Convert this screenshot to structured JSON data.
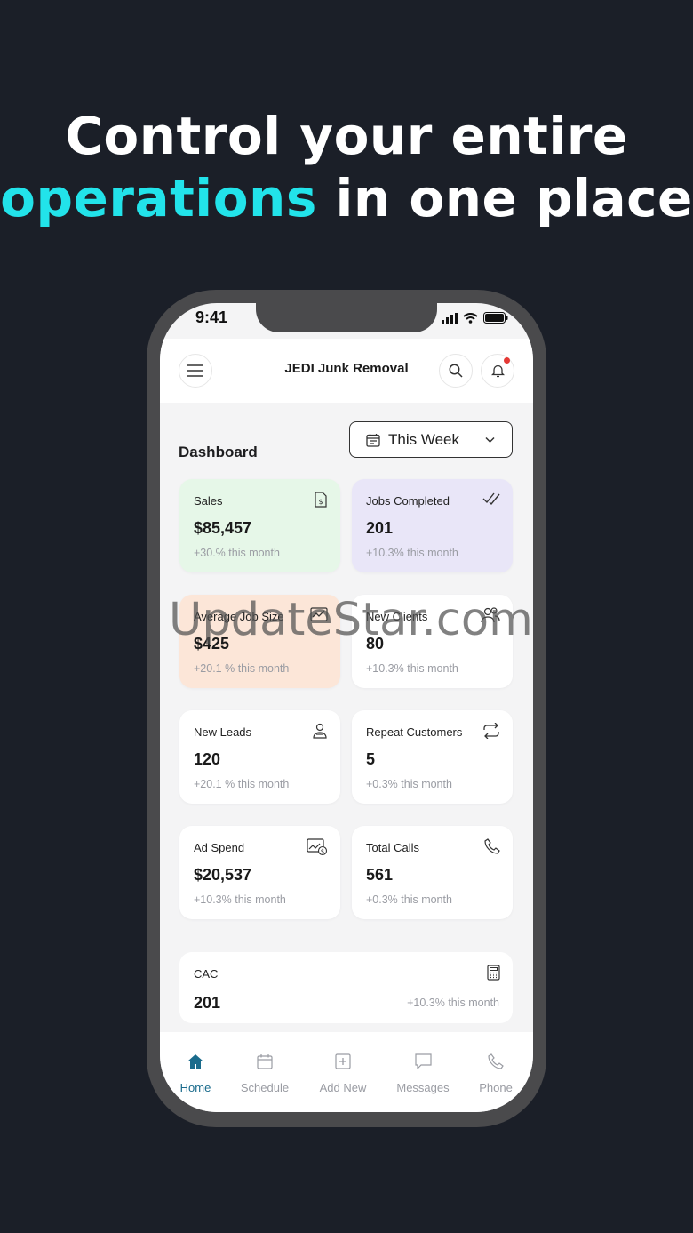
{
  "headline": {
    "line1": "Control your entire",
    "accent": "operations",
    "rest": " in one place"
  },
  "status": {
    "time": "9:41"
  },
  "appbar": {
    "title": "JEDI Junk Removal",
    "menu_icon": "menu-icon",
    "search_icon": "search-icon",
    "bell_icon": "bell-icon"
  },
  "dashboard": {
    "title": "Dashboard",
    "period": "This Week"
  },
  "cards": [
    {
      "label": "Sales",
      "value": "$85,457",
      "delta": "+30.% this month",
      "icon": "invoice-dollar-icon"
    },
    {
      "label": "Jobs Completed",
      "value": "201",
      "delta": "+10.3% this month",
      "icon": "double-check-icon"
    },
    {
      "label": "Average Job Size",
      "value": "$425",
      "delta": "+20.1 % this month",
      "icon": "trend-icon"
    },
    {
      "label": "New Clients",
      "value": "80",
      "delta": "+10.3% this month",
      "icon": "users-icon"
    },
    {
      "label": "New Leads",
      "value": "120",
      "delta": "+20.1 % this month",
      "icon": "user-lead-icon"
    },
    {
      "label": "Repeat Customers",
      "value": "5",
      "delta": "+0.3% this month",
      "icon": "repeat-icon"
    },
    {
      "label": "Ad Spend",
      "value": "$20,537",
      "delta": "+10.3% this month",
      "icon": "ad-spend-icon"
    },
    {
      "label": "Total Calls",
      "value": "561",
      "delta": "+0.3% this month",
      "icon": "phone-icon"
    }
  ],
  "cac": {
    "label": "CAC",
    "value": "201",
    "delta": "+10.3% this month",
    "icon": "calculator-icon"
  },
  "tabs": [
    {
      "label": "Home",
      "icon": "home-icon"
    },
    {
      "label": "Schedule",
      "icon": "calendar-icon"
    },
    {
      "label": "Add New",
      "icon": "add-icon"
    },
    {
      "label": "Messages",
      "icon": "message-icon"
    },
    {
      "label": "Phone",
      "icon": "phone-icon"
    }
  ],
  "watermark": "UpdateStar.com",
  "colors": {
    "background": "#1b1f28",
    "accent": "#22e3ea",
    "active_tab": "#1a6b8c",
    "sales_card": "#e6f7e8",
    "jobs_card": "#e9e6f8",
    "avg_card": "#fce6d8"
  }
}
